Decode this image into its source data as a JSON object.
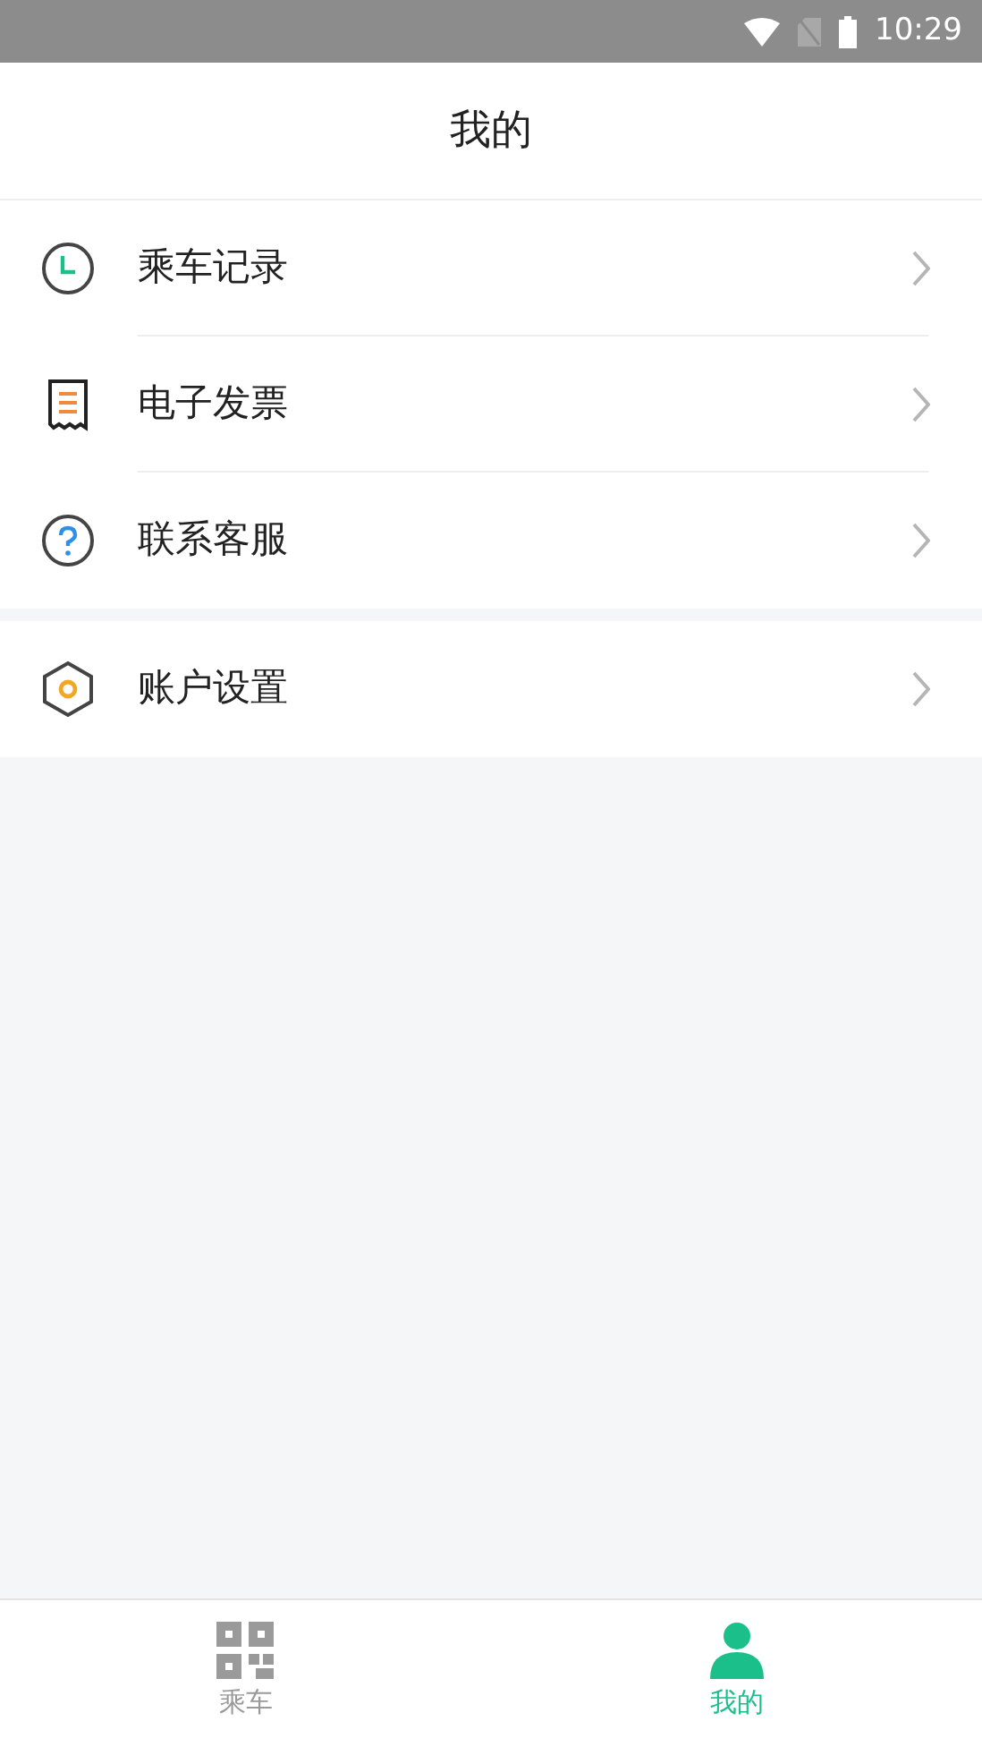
{
  "status_bar": {
    "time": "10:29"
  },
  "header": {
    "title": "我的"
  },
  "menu_groups": [
    {
      "items": [
        {
          "kind": "clock",
          "label": "乘车记录"
        },
        {
          "kind": "receipt",
          "label": "电子发票"
        },
        {
          "kind": "help",
          "label": "联系客服"
        }
      ]
    },
    {
      "items": [
        {
          "kind": "hexagon",
          "label": "账户设置"
        }
      ]
    }
  ],
  "tab_bar": [
    {
      "kind": "qr",
      "label": "乘车",
      "selected": false
    },
    {
      "kind": "person",
      "label": "我的",
      "selected": true
    }
  ]
}
